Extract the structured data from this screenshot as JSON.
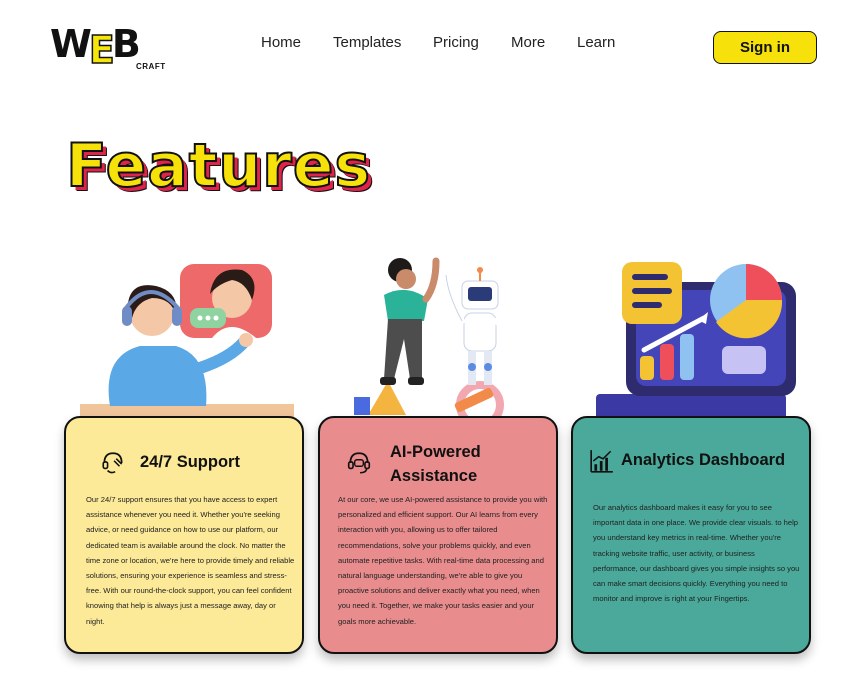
{
  "brand": {
    "logo_word": "WEB",
    "logo_sub": "CRAFT"
  },
  "nav": {
    "items": [
      {
        "label": "Home"
      },
      {
        "label": "Templates"
      },
      {
        "label": "Pricing"
      },
      {
        "label": "More"
      },
      {
        "label": "Learn"
      }
    ],
    "signin_label": "Sign in"
  },
  "page_title": "Features",
  "colors": {
    "yellow": "#fcea98",
    "pink": "#e88c8d",
    "teal": "#4aa99a",
    "accent": "#f7e10a"
  },
  "features": [
    {
      "icon": "support-agent-icon",
      "title": "24/7 Support",
      "body": "Our 24/7 support ensures that you have access to expert assistance whenever you need it. Whether you're seeking advice, or need guidance on how to use our platform, our dedicated team is available around the clock. No matter the time zone or location, we're here to provide timely and reliable solutions, ensuring your experience is seamless and stress-free. With our round-the-clock support, you can feel confident knowing that help is always just a message away, day or night."
    },
    {
      "icon": "headset-chat-icon",
      "title": "AI-Powered Assistance",
      "body": "At our core, we use AI-powered assistance to provide you with personalized and efficient support. Our AI learns from every interaction with you, allowing us to offer tailored recommendations, solve your problems quickly, and even automate repetitive tasks. With real-time data processing and natural language understanding, we're able to give you proactive solutions and deliver exactly what you need, when you need it. Together, we make your tasks easier and your goals more achievable."
    },
    {
      "icon": "analytics-chart-icon",
      "title": "Analytics Dashboard",
      "body": "Our analytics dashboard makes it easy for you to see important data in one place. We provide clear visuals. to help you understand key metrics in real-time. Whether you're tracking website traffic, user activity, or business performance, our dashboard gives you simple insights so you can make smart decisions quickly. Everything you need to monitor and improve is right at your Fingertips."
    }
  ]
}
